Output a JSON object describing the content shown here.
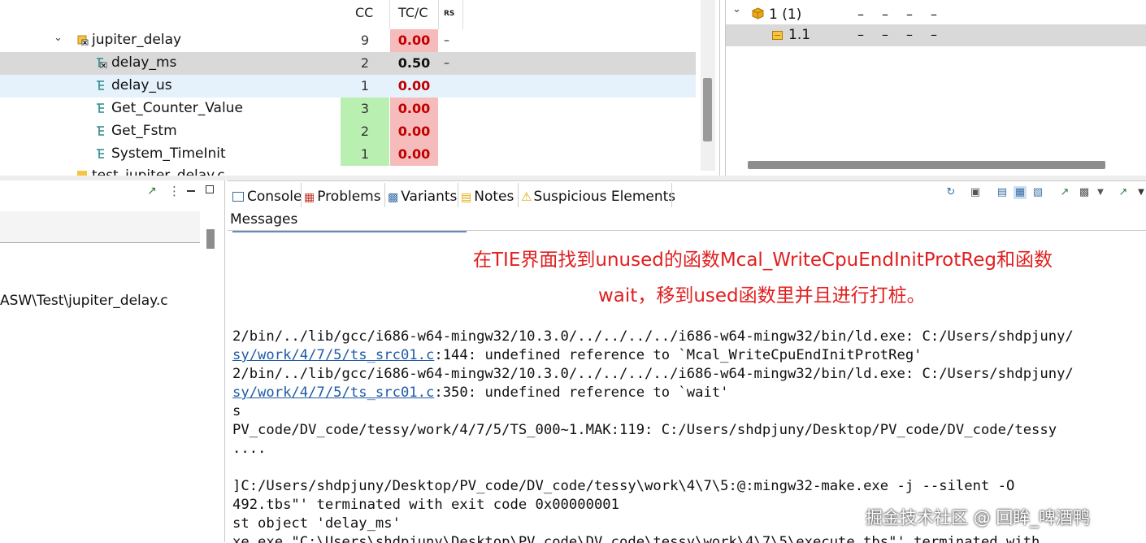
{
  "tree": {
    "headers": {
      "cc": "CC",
      "tc": "TC/C",
      "rs": "RS"
    },
    "rows": [
      {
        "label": "jupiter_delay",
        "cc": "9",
        "tc": "0.00",
        "rs": "–"
      },
      {
        "label": "delay_ms",
        "cc": "2",
        "tc": "0.50",
        "rs": "–"
      },
      {
        "label": "delay_us",
        "cc": "1",
        "tc": "0.00",
        "rs": ""
      },
      {
        "label": "Get_Counter_Value",
        "cc": "3",
        "tc": "0.00",
        "rs": ""
      },
      {
        "label": "Get_Fstm",
        "cc": "2",
        "tc": "0.00",
        "rs": ""
      },
      {
        "label": "System_TimeInit",
        "cc": "1",
        "tc": "0.00",
        "rs": ""
      }
    ],
    "cut_label": "test_jupiter_delay.c"
  },
  "right_tree": {
    "rows": [
      {
        "label": "1 (1)",
        "dashes": [
          "–",
          "–",
          "–",
          "–"
        ]
      },
      {
        "label": "1.1",
        "dashes": [
          "–",
          "–",
          "–",
          "–"
        ]
      }
    ]
  },
  "left_lower": {
    "path_text": "ASW\\Test\\jupiter_delay.c"
  },
  "console": {
    "tabs": [
      {
        "label": "Console"
      },
      {
        "label": "Problems"
      },
      {
        "label": "Variants"
      },
      {
        "label": "Notes"
      },
      {
        "label": "Suspicious Elements"
      }
    ],
    "messages_header": "Messages",
    "lines": {
      "l1": "2/bin/../lib/gcc/i686-w64-mingw32/10.3.0/../../../../i686-w64-mingw32/bin/ld.exe: C:/Users/shdpjuny/",
      "l2_link": "sy/work/4/7/5/ts_src01.c",
      "l2_rest": ":144: undefined reference to `Mcal_WriteCpuEndInitProtReg'",
      "l3": "2/bin/../lib/gcc/i686-w64-mingw32/10.3.0/../../../../i686-w64-mingw32/bin/ld.exe: C:/Users/shdpjuny/",
      "l4_link": "sy/work/4/7/5/ts_src01.c",
      "l4_rest": ":350: undefined reference to `wait'",
      "l5": "s",
      "l6": "PV_code/DV_code/tessy/work/4/7/5/TS_000~1.MAK:119: C:/Users/shdpjuny/Desktop/PV_code/DV_code/tessy",
      "l7": "....",
      "l8": "]C:/Users/shdpjuny/Desktop/PV_code/DV_code/tessy\\work\\4\\7\\5:@:mingw32-make.exe -j --silent -O",
      "l9": "492.tbs\"' terminated with exit code 0x00000001",
      "l10": "st object 'delay_ms'",
      "l11": "xe.exe \"C:\\Users\\shdpjuny\\Desktop\\PV_code\\DV_code\\tessy\\work\\4\\7\\5\\execute.tbs\"' terminated with"
    },
    "annotation": {
      "line1": "在TIE界面找到unused的函数Mcal_WriteCpuEndInitProtReg和函数",
      "line2": "wait，移到used函数里并且进行打桩。"
    }
  },
  "watermark": "掘金技术社区 @ 回眸_啤酒鸭",
  "colors": {
    "tc_red_bg": "#f6bcbc",
    "cc_green_bg": "#b9f0b2",
    "annotation_red": "#e02020",
    "link_blue": "#1f5aa8",
    "selection_gray": "#d9d9d9"
  }
}
